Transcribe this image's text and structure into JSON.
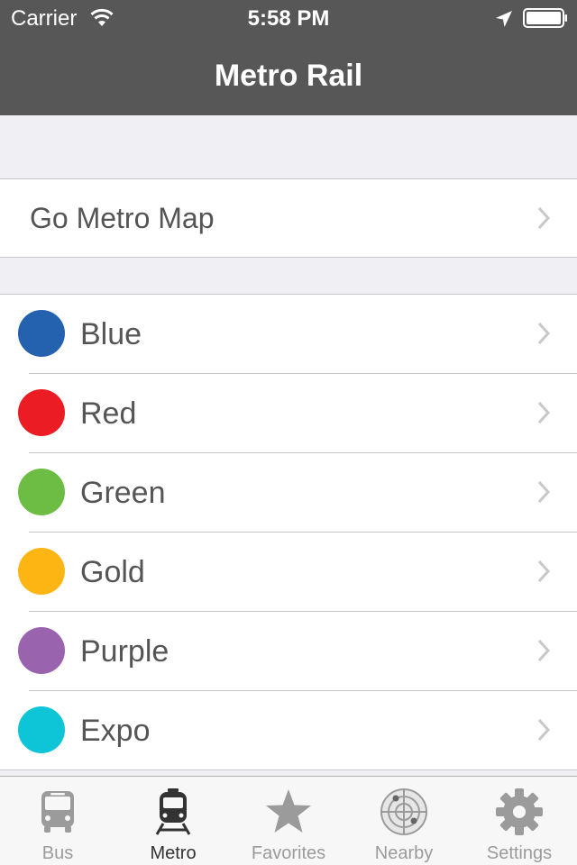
{
  "status_bar": {
    "carrier": "Carrier",
    "time": "5:58 PM"
  },
  "nav": {
    "title": "Metro Rail"
  },
  "map_row": {
    "label": "Go Metro Map"
  },
  "lines": [
    {
      "label": "Blue",
      "color": "#2461ae"
    },
    {
      "label": "Red",
      "color": "#ec1c24"
    },
    {
      "label": "Green",
      "color": "#6dbd45"
    },
    {
      "label": "Gold",
      "color": "#fdb514"
    },
    {
      "label": "Purple",
      "color": "#9a63ad"
    },
    {
      "label": "Expo",
      "color": "#0dc5d6"
    }
  ],
  "tabs": [
    {
      "label": "Bus",
      "icon": "bus-icon",
      "active": false
    },
    {
      "label": "Metro",
      "icon": "train-icon",
      "active": true
    },
    {
      "label": "Favorites",
      "icon": "star-icon",
      "active": false
    },
    {
      "label": "Nearby",
      "icon": "radar-icon",
      "active": false
    },
    {
      "label": "Settings",
      "icon": "gear-icon",
      "active": false
    }
  ],
  "colors": {
    "nav_background": "#575757",
    "tab_active": "#333333",
    "tab_inactive": "#9b9b9b"
  }
}
